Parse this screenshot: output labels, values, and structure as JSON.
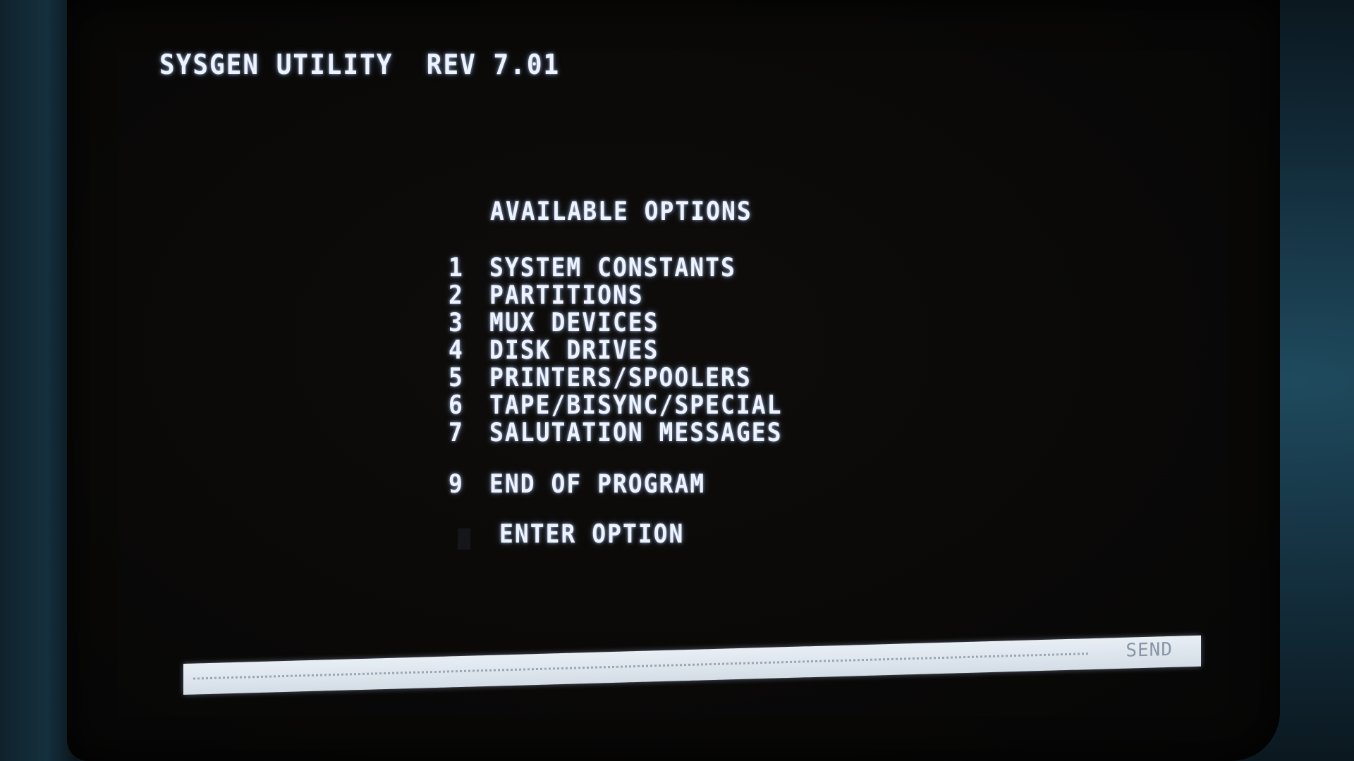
{
  "header": {
    "title": "SYSGEN UTILITY  REV 7.01"
  },
  "menu": {
    "heading": "AVAILABLE OPTIONS",
    "items": [
      {
        "number": "1",
        "label": "SYSTEM CONSTANTS"
      },
      {
        "number": "2",
        "label": "PARTITIONS"
      },
      {
        "number": "3",
        "label": "MUX DEVICES"
      },
      {
        "number": "4",
        "label": "DISK DRIVES"
      },
      {
        "number": "5",
        "label": "PRINTERS/SPOOLERS"
      },
      {
        "number": "6",
        "label": "TAPE/BISYNC/SPECIAL"
      },
      {
        "number": "7",
        "label": "SALUTATION MESSAGES"
      },
      {
        "number": "9",
        "label": "END OF PROGRAM"
      }
    ]
  },
  "prompt": {
    "label": "ENTER OPTION"
  },
  "status_bar": {
    "send_label": "SEND"
  },
  "colors": {
    "phosphor": "#eef3ff",
    "screen": "#0a0908",
    "send_bar": "#e8eef4"
  }
}
